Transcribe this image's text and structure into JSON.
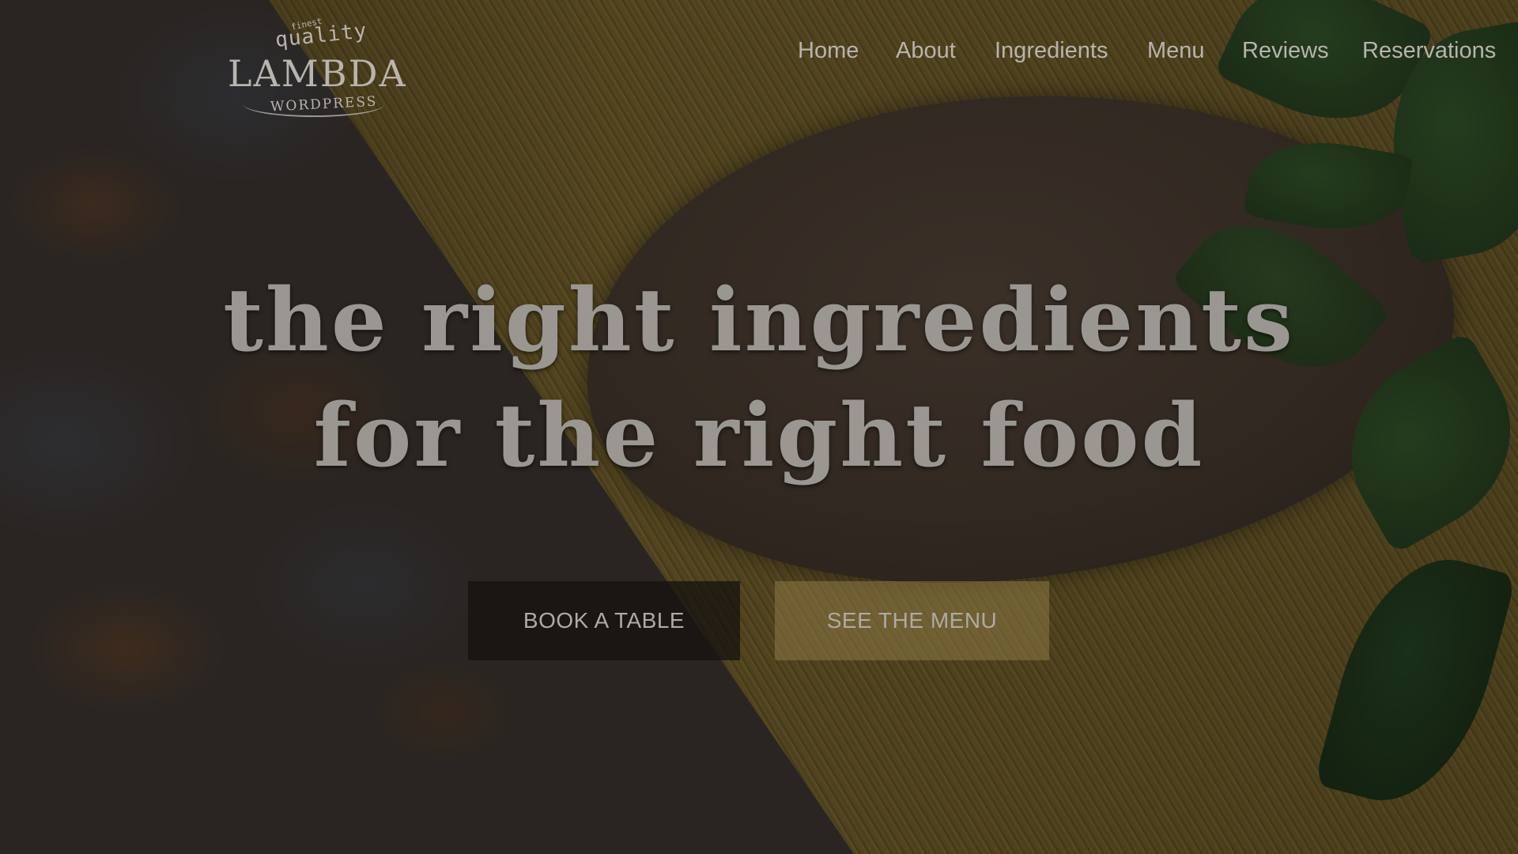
{
  "logo": {
    "finest": "finest",
    "quality": "quality",
    "name": "LAMBDA",
    "sub": "WORDPRESS"
  },
  "nav": {
    "items": [
      "Home",
      "About",
      "Ingredients",
      "Menu",
      "Reviews",
      "Reservations"
    ]
  },
  "hero": {
    "line1": "the right ingredients",
    "line2": "for the right food",
    "buttons": {
      "book": "BOOK A TABLE",
      "menu": "SEE THE MENU"
    }
  },
  "colors": {
    "overlay": "#0f0d0c",
    "text": "#b8b3ad",
    "pasta": "#8e7731",
    "basil": "#36602c",
    "spoon": "#4b3d31"
  }
}
